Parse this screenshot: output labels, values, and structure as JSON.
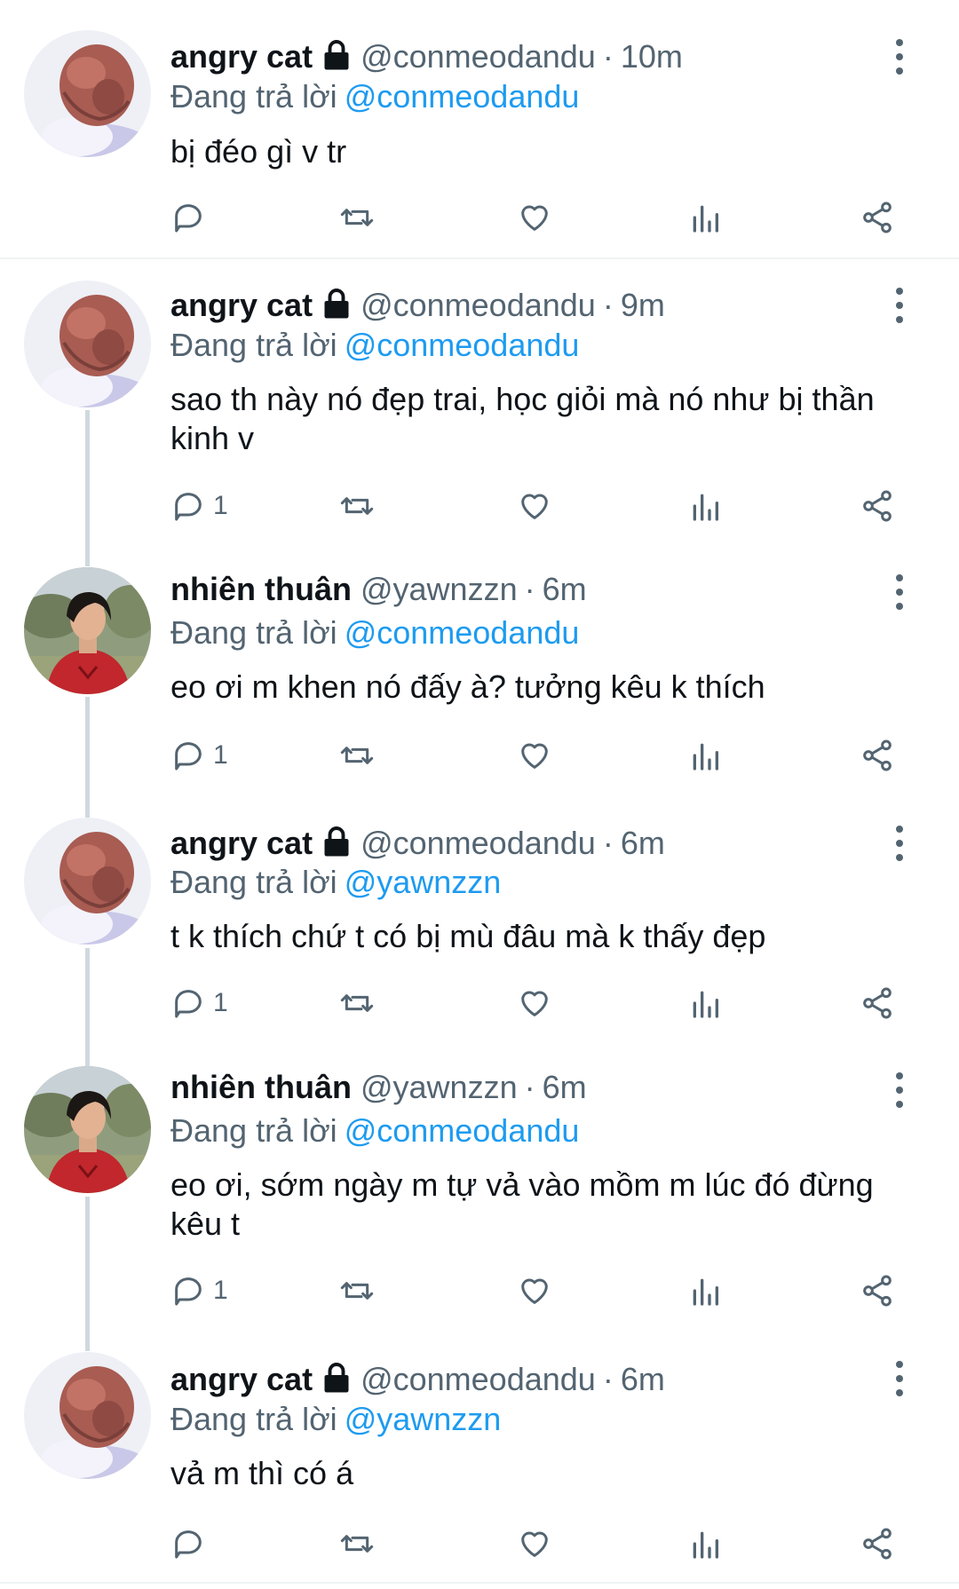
{
  "colors": {
    "accent": "#1d9bf0",
    "secondary_text": "#536471",
    "thread_line": "#cfd9de"
  },
  "icons": {
    "lock": "lock-icon",
    "more": "more-icon",
    "reply": "reply-icon",
    "retweet": "retweet-icon",
    "like": "heart-icon",
    "stats": "stats-icon",
    "share": "share-icon"
  },
  "tweets": [
    {
      "name": "angry cat",
      "protected": true,
      "handle": "@conmeodandu",
      "dot": "·",
      "time": "10m",
      "replying_label": "Đang trả lời",
      "replying_to": "@conmeodandu",
      "text": "bị đéo gì v tr",
      "reply_count": ""
    },
    {
      "name": "angry cat",
      "protected": true,
      "handle": "@conmeodandu",
      "dot": "·",
      "time": "9m",
      "replying_label": "Đang trả lời",
      "replying_to": "@conmeodandu",
      "text": "sao th này nó đẹp trai, học giỏi mà nó như bị thần kinh v",
      "reply_count": "1"
    },
    {
      "name": "nhiên thuân",
      "protected": false,
      "handle": "@yawnzzn",
      "dot": "·",
      "time": "6m",
      "replying_label": "Đang trả lời",
      "replying_to": "@conmeodandu",
      "text": "eo ơi m khen nó đấy à? tưởng kêu k thích",
      "reply_count": "1"
    },
    {
      "name": "angry cat",
      "protected": true,
      "handle": "@conmeodandu",
      "dot": "·",
      "time": "6m",
      "replying_label": "Đang trả lời",
      "replying_to": "@yawnzzn",
      "text": "t k thích chứ t có bị mù đâu mà k thấy đẹp",
      "reply_count": "1"
    },
    {
      "name": "nhiên thuân",
      "protected": false,
      "handle": "@yawnzzn",
      "dot": "·",
      "time": "6m",
      "replying_label": "Đang trả lời",
      "replying_to": "@conmeodandu",
      "text": "eo ơi, sớm ngày m tự vả vào mồm m lúc đó đừng kêu t",
      "reply_count": "1"
    },
    {
      "name": "angry cat",
      "protected": true,
      "handle": "@conmeodandu",
      "dot": "·",
      "time": "6m",
      "replying_label": "Đang trả lời",
      "replying_to": "@yawnzzn",
      "text": "vả m thì có á",
      "reply_count": ""
    }
  ]
}
